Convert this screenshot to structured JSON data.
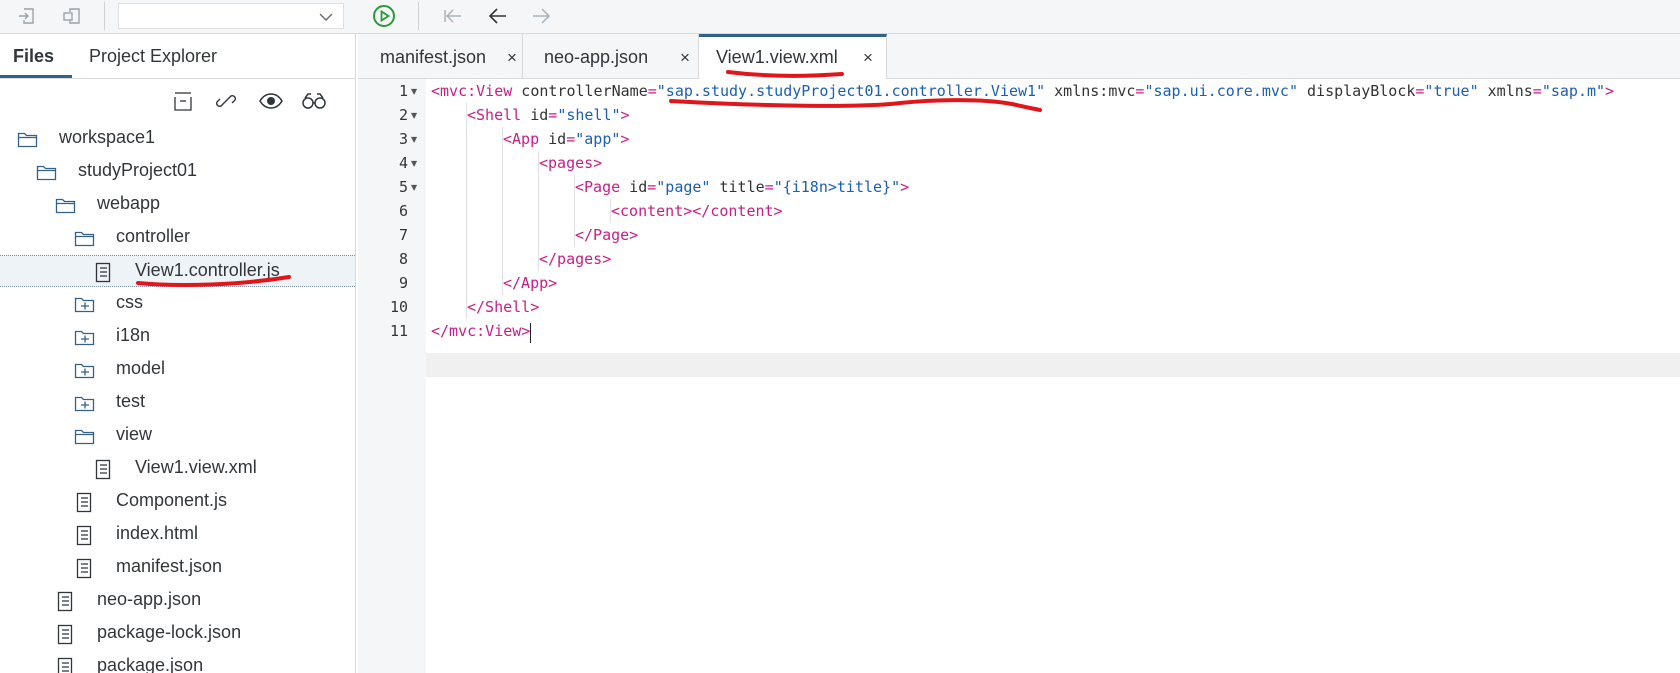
{
  "toolbar": {
    "buttons": [
      "import-icon",
      "export-icon",
      "run-icon",
      "back-alt-icon",
      "back-icon",
      "forward-icon"
    ],
    "select_value": ""
  },
  "left_panel": {
    "tabs": [
      "Files",
      "Project Explorer"
    ],
    "active_tab": "Files",
    "icons": [
      "collapse-all-icon",
      "link-editor-icon",
      "show-hidden-icon",
      "search-icon"
    ],
    "tree": [
      {
        "label": "workspace1",
        "type": "folder-open",
        "depth": 0
      },
      {
        "label": "studyProject01",
        "type": "folder-open",
        "depth": 1
      },
      {
        "label": "webapp",
        "type": "folder-open",
        "depth": 2
      },
      {
        "label": "controller",
        "type": "folder-open",
        "depth": 3
      },
      {
        "label": "View1.controller.js",
        "type": "file",
        "depth": 4,
        "selected": true
      },
      {
        "label": "css",
        "type": "folder-closed",
        "depth": 3
      },
      {
        "label": "i18n",
        "type": "folder-closed",
        "depth": 3
      },
      {
        "label": "model",
        "type": "folder-closed",
        "depth": 3
      },
      {
        "label": "test",
        "type": "folder-closed",
        "depth": 3
      },
      {
        "label": "view",
        "type": "folder-open",
        "depth": 3
      },
      {
        "label": "View1.view.xml",
        "type": "file",
        "depth": 4
      },
      {
        "label": "Component.js",
        "type": "file",
        "depth": 3
      },
      {
        "label": "index.html",
        "type": "file",
        "depth": 3
      },
      {
        "label": "manifest.json",
        "type": "file",
        "depth": 3
      },
      {
        "label": "neo-app.json",
        "type": "file",
        "depth": 2
      },
      {
        "label": "package-lock.json",
        "type": "file",
        "depth": 2
      },
      {
        "label": "package.json",
        "type": "file",
        "depth": 2
      }
    ]
  },
  "editor": {
    "tabs": [
      {
        "label": "manifest.json",
        "close": "×"
      },
      {
        "label": "neo-app.json",
        "close": "×"
      },
      {
        "label": "View1.view.xml",
        "close": "×",
        "active": true
      }
    ],
    "lines": [
      {
        "n": "1",
        "fold": true,
        "indent": 0,
        "tokens": [
          [
            "tag",
            "<mvc:View"
          ],
          [
            "attr",
            " controllerName"
          ],
          [
            "eq",
            "="
          ],
          [
            "val",
            "\"sap.study.studyProject01.controller.View1\""
          ],
          [
            "attr",
            " xmlns:mvc"
          ],
          [
            "eq",
            "="
          ],
          [
            "val",
            "\"sap.ui.core.mvc\""
          ],
          [
            "attr",
            " displayBlock"
          ],
          [
            "eq",
            "="
          ],
          [
            "val",
            "\"true\""
          ],
          [
            "attr",
            " xmlns"
          ],
          [
            "eq",
            "="
          ],
          [
            "val",
            "\"sap.m\""
          ],
          [
            "tag",
            ">"
          ]
        ]
      },
      {
        "n": "2",
        "fold": true,
        "indent": 1,
        "tokens": [
          [
            "tag",
            "<Shell"
          ],
          [
            "attr",
            " id"
          ],
          [
            "eq",
            "="
          ],
          [
            "val",
            "\"shell\""
          ],
          [
            "tag",
            ">"
          ]
        ]
      },
      {
        "n": "3",
        "fold": true,
        "indent": 2,
        "tokens": [
          [
            "tag",
            "<App"
          ],
          [
            "attr",
            " id"
          ],
          [
            "eq",
            "="
          ],
          [
            "val",
            "\"app\""
          ],
          [
            "tag",
            ">"
          ]
        ]
      },
      {
        "n": "4",
        "fold": true,
        "indent": 3,
        "tokens": [
          [
            "tag",
            "<pages>"
          ]
        ]
      },
      {
        "n": "5",
        "fold": true,
        "indent": 4,
        "tokens": [
          [
            "tag",
            "<Page"
          ],
          [
            "attr",
            " id"
          ],
          [
            "eq",
            "="
          ],
          [
            "val",
            "\"page\""
          ],
          [
            "attr",
            " title"
          ],
          [
            "eq",
            "="
          ],
          [
            "val",
            "\"{i18n>title}\""
          ],
          [
            "tag",
            ">"
          ]
        ]
      },
      {
        "n": "6",
        "fold": false,
        "indent": 5,
        "tokens": [
          [
            "tag",
            "<content></content>"
          ]
        ]
      },
      {
        "n": "7",
        "fold": false,
        "indent": 4,
        "tokens": [
          [
            "tag",
            "</Page>"
          ]
        ]
      },
      {
        "n": "8",
        "fold": false,
        "indent": 3,
        "tokens": [
          [
            "tag",
            "</pages>"
          ]
        ]
      },
      {
        "n": "9",
        "fold": false,
        "indent": 2,
        "tokens": [
          [
            "tag",
            "</App>"
          ]
        ]
      },
      {
        "n": "10",
        "fold": false,
        "indent": 1,
        "tokens": [
          [
            "tag",
            "</Shell>"
          ]
        ]
      },
      {
        "n": "11",
        "fold": false,
        "indent": 0,
        "tokens": [
          [
            "tag",
            "</mvc:View>"
          ]
        ]
      }
    ]
  },
  "colors": {
    "tag": "#c91e85",
    "value": "#1a5fb4",
    "annotation": "#e0161a",
    "accent": "#346187"
  }
}
